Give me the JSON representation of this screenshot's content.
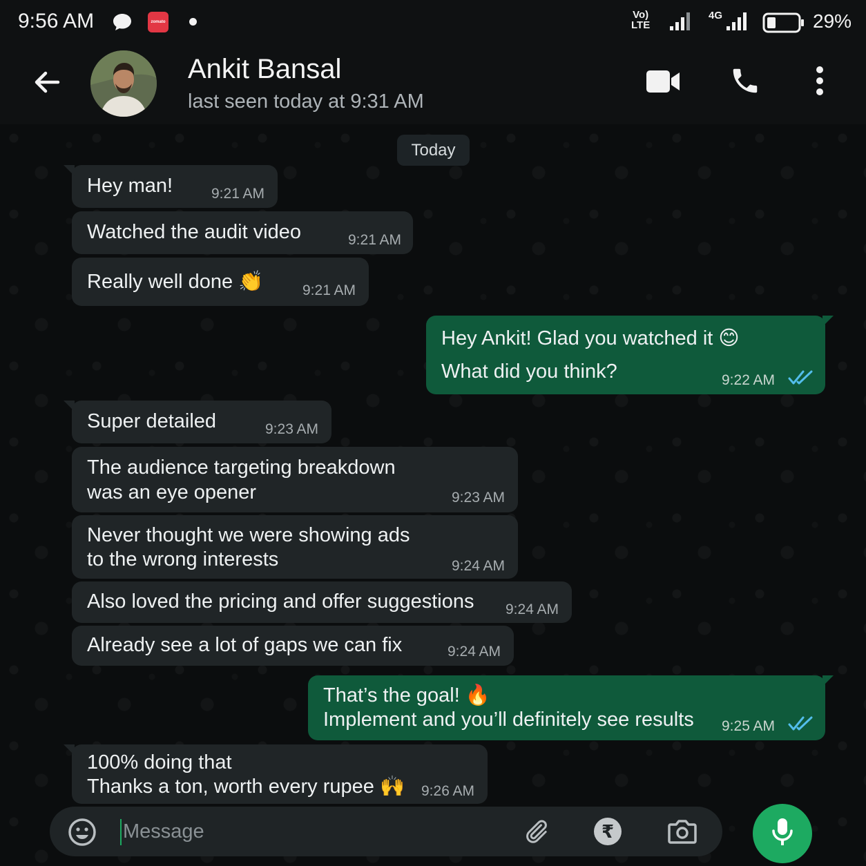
{
  "status_bar": {
    "time": "9:56 AM",
    "volte_label": "Vo)\nLTE",
    "network_label": "4G",
    "battery_percent": "29%",
    "battery_level": 0.29,
    "zomato_label": "zomato",
    "icons": [
      "chat-bubble-icon",
      "zomato-icon",
      "notification-dot-icon",
      "signal-icon",
      "battery-icon"
    ]
  },
  "header": {
    "contact_name": "Ankit Bansal",
    "last_seen": "last seen today at 9:31 AM",
    "icons": [
      "back-arrow-icon",
      "video-call-icon",
      "phone-icon",
      "more-vertical-icon"
    ]
  },
  "chat": {
    "date_label": "Today",
    "messages": [
      {
        "dir": "in",
        "lines": "Hey man!",
        "time": "9:21 AM"
      },
      {
        "dir": "in",
        "lines": "Watched the audit video",
        "time": "9:21 AM"
      },
      {
        "dir": "in",
        "lines": "Really well done 👏",
        "time": "9:21 AM"
      },
      {
        "dir": "out",
        "line1": "Hey Ankit! Glad you watched it 😊",
        "line2": "What did you think?",
        "time": "9:22 AM",
        "status": "read"
      },
      {
        "dir": "in",
        "lines": "Super detailed",
        "time": "9:23 AM"
      },
      {
        "dir": "in",
        "line1": "The audience targeting breakdown",
        "line2": "was an eye opener",
        "time": "9:23 AM"
      },
      {
        "dir": "in",
        "line1": "Never thought we were showing ads",
        "line2": "to the wrong interests",
        "time": "9:24 AM"
      },
      {
        "dir": "in",
        "lines": "Also loved the pricing and offer suggestions",
        "time": "9:24 AM"
      },
      {
        "dir": "in",
        "lines": "Already see a lot of gaps we can fix",
        "time": "9:24 AM"
      },
      {
        "dir": "out",
        "line1": "That’s the goal! 🔥",
        "line2": "Implement and you’ll definitely see results",
        "time": "9:25 AM",
        "status": "read"
      },
      {
        "dir": "in",
        "line1": "100% doing that",
        "line2": "Thanks a ton, worth every rupee 🙌",
        "time": "9:26 AM"
      }
    ]
  },
  "composer": {
    "placeholder": "Message",
    "rupee_symbol": "₹",
    "icons": [
      "emoji-icon",
      "attach-icon",
      "rupee-icon",
      "camera-icon",
      "mic-icon"
    ]
  },
  "colors": {
    "incoming_bubble": "#202527",
    "outgoing_bubble": "#0f5a3b",
    "read_ticks": "#53bdeb",
    "accent": "#1daa61"
  }
}
